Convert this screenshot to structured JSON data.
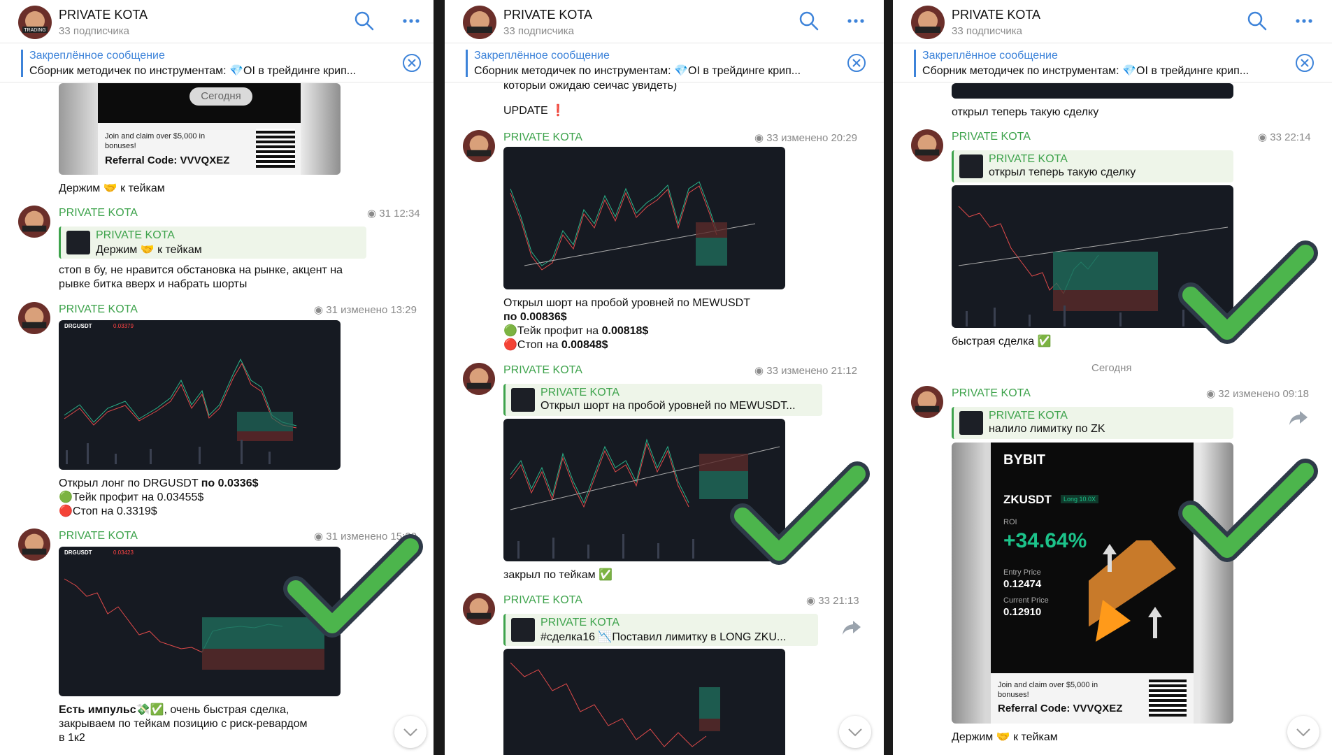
{
  "channel": {
    "title": "PRIVATE KOTA",
    "subscribers": "33 подписчика"
  },
  "pinned": {
    "label": "Закреплённое сообщение",
    "text": "Сборник методичек по инструментам:  💎OI в трейдинге крип..."
  },
  "colors": {
    "accent": "#3d83d9",
    "sender": "#3ea34c",
    "check": "#4cb54c",
    "reply_bg": "#eef5e9"
  },
  "icons": [
    "search-icon",
    "more-icon",
    "close-icon",
    "scroll-down-icon",
    "forward-icon",
    "check-icon"
  ],
  "panel1": {
    "promo": {
      "badge": "Сегодня",
      "claim": "Join and claim over $5,000 in bonuses!",
      "code": "Referral Code: VVVQXEZ"
    },
    "caption0": "Держим 🤝 к тейкам",
    "msg1": {
      "sender": "PRIVATE KOTA",
      "meta": "31 12:34",
      "reply_sender": "PRIVATE KOTA",
      "reply_text": "Держим 🤝 к тейкам",
      "text1": "стоп в бу, не нравится обстановка на рынке, акцент на",
      "text2": "рывке битка вверх и набрать шорты"
    },
    "msg2": {
      "sender": "PRIVATE KOTA",
      "meta": "31 изменено 13:29",
      "symbol": "DRGUSDT",
      "price": "0.03379",
      "line1a": "Открыл лонг по DRGUSDT ",
      "line1b": "по 0.0336$",
      "line2": "🟢Тейк профит на 0.03455$",
      "line3": "🔴Стоп на 0.3319$"
    },
    "msg3": {
      "sender": "PRIVATE KOTA",
      "meta": "31 изменено 15:20",
      "symbol": "DRGUSDT",
      "price": "0.03423",
      "line1a": "Есть импульс",
      "line1b": "💸✅, очень быстрая сделка,",
      "line2": "закрываем по тейкам позицию с риск-ревардом",
      "line3": "в 1к2"
    }
  },
  "panel2": {
    "top1": "который ожидаю сейчас увидеть)",
    "top2": "UPDATE ❗️",
    "msg1": {
      "sender": "PRIVATE KOTA",
      "meta": "33 изменено 20:29",
      "line1": "Открыл шорт на пробой уровней по MEWUSDT",
      "line2": "по 0.00836$",
      "line3a": "🟢Тейк профит на ",
      "line3b": "0.00818$",
      "line4a": "🔴Стоп на ",
      "line4b": "0.00848$"
    },
    "msg2": {
      "sender": "PRIVATE KOTA",
      "meta": "33 изменено 21:12",
      "reply_sender": "PRIVATE KOTA",
      "reply_text": "Открыл шорт на пробой уровней по MEWUSDT...",
      "caption": "закрыл по тейкам ✅"
    },
    "msg3": {
      "sender": "PRIVATE KOTA",
      "meta": "33 21:13",
      "reply_sender": "PRIVATE KOTA",
      "reply_text": "#сделка16 📉Поставил лимитку в  LONG ZKU..."
    }
  },
  "panel3": {
    "top1": "открыл теперь такую сделку",
    "msg1": {
      "sender": "PRIVATE KOTA",
      "meta": "33 22:14",
      "reply_sender": "PRIVATE KOTA",
      "reply_text": "открыл теперь такую сделку",
      "caption": "быстрая сделка ✅"
    },
    "date": "Сегодня",
    "msg2": {
      "sender": "PRIVATE KOTA",
      "meta": "32 изменено 09:18",
      "reply_sender": "PRIVATE KOTA",
      "reply_text": "налило лимитку по ZK",
      "card": {
        "brand": "BYBIT",
        "pair": "ZKUSDT",
        "lev": "Long 10.0X",
        "roi_label": "ROI",
        "roi": "+34.64%",
        "entry_label": "Entry Price",
        "entry": "0.12474",
        "cur_label": "Current Price",
        "cur": "0.12910",
        "claim": "Join and claim over $5,000 in bonuses!",
        "code": "Referral Code: VVVQXEZ"
      },
      "caption": "Держим 🤝 к тейкам"
    }
  }
}
